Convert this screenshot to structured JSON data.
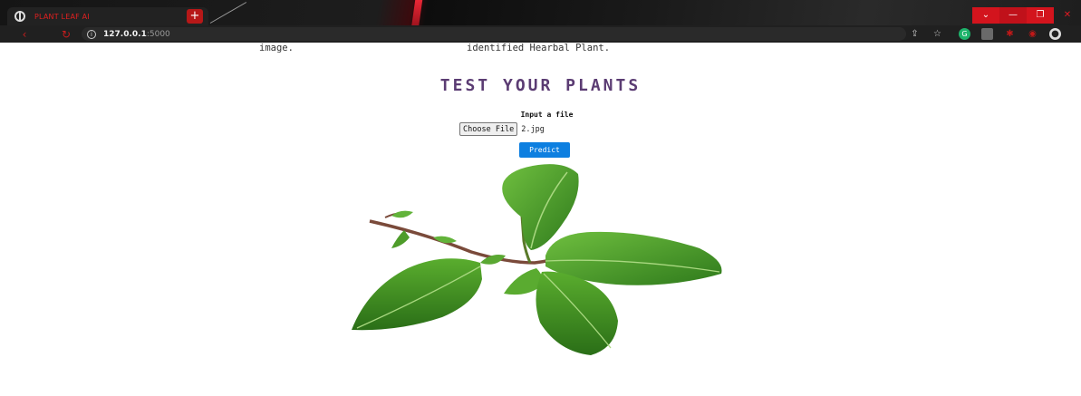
{
  "browser": {
    "tab_title": "PLANT LEAF AI",
    "tab_close": "×",
    "new_tab": "+",
    "url_host": "127.0.0.1",
    "url_port": ":5000",
    "window_minimize": "—",
    "window_restore": "❐",
    "window_close": "✕",
    "window_chevron": "⌄"
  },
  "page": {
    "previous_text_left": "image.",
    "previous_text_right": "identified Hearbal Plant.",
    "heading": "TEST YOUR PLANTS",
    "input_label": "Input a file",
    "choose_file_label": "Choose File",
    "selected_file": "2.jpg",
    "predict_label": "Predict"
  },
  "colors": {
    "heading": "#5b3c73",
    "predict_button": "#0d7fe0",
    "browser_accent": "#d3141d"
  },
  "icons": {
    "tab_icon": "globe-icon",
    "reload": "reload-icon",
    "site_info": "info-icon",
    "share": "share-icon",
    "bookmark": "star-icon",
    "extensions": [
      "green-circle-extension-icon",
      "gray-extension-icon",
      "red-extension-icon",
      "red-extension-icon",
      "profile-avatar-icon"
    ],
    "leaf_image": "mint-leaf-image"
  }
}
